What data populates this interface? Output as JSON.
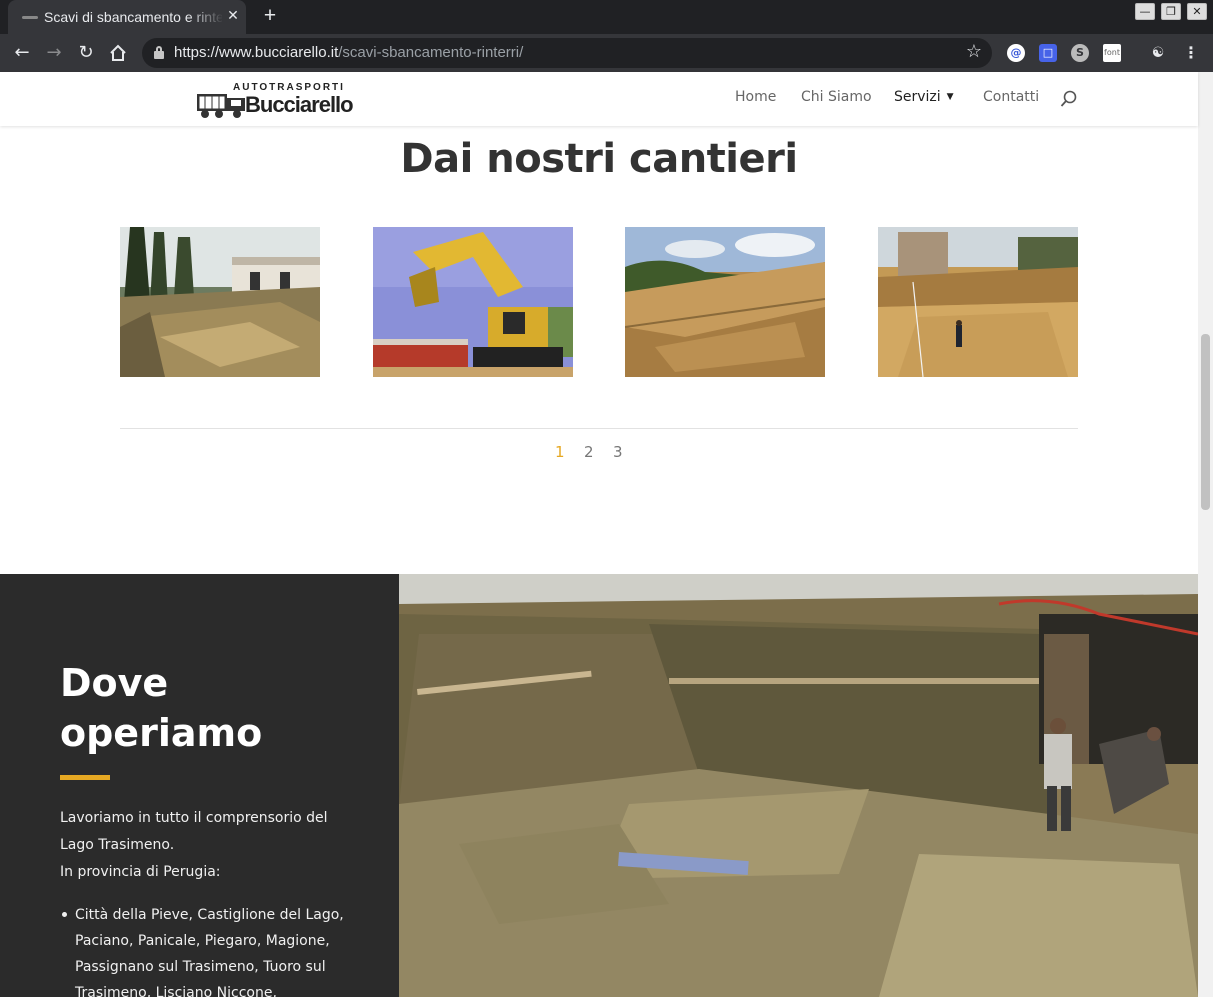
{
  "browser": {
    "tab_title": "Scavi di sbancamento e rinterri",
    "new_tab": "+",
    "close_tab": "✕",
    "url_domain": "https://www.bucciarello.it",
    "url_path": "/scavi-sbancamento-rinterri/",
    "window_controls": [
      "—",
      "❐",
      "✕"
    ],
    "extensions": [
      "at-icon",
      "cursor-icon",
      "sync-icon",
      "font-icon",
      "eye-icon",
      "menu-icon"
    ]
  },
  "site": {
    "logo_top": "AUTOTRASPORTI",
    "logo_main": "Bucciarello",
    "menu": [
      {
        "label": "Home"
      },
      {
        "label": "Chi Siamo"
      },
      {
        "label": "Servizi"
      },
      {
        "label": "Contatti"
      }
    ]
  },
  "gallery": {
    "title": "Dai nostri cantieri",
    "pages": [
      "1",
      "2",
      "3"
    ],
    "current_page": "1"
  },
  "dove": {
    "title": "Dove operiamo",
    "text_line1": "Lavoriamo in tutto il comprensorio del Lago Trasimeno.",
    "text_line2": "In provincia di Perugia:",
    "list_item": "Città della Pieve, Castiglione del Lago, Paciano, Panicale, Piegaro, Magione, Passignano sul Trasimeno, Tuoro sul Trasimeno, Lisciano Niccone,"
  },
  "colors": {
    "accent": "#e6a823",
    "dark_panel": "#2b2b2b",
    "heading": "#333333"
  }
}
